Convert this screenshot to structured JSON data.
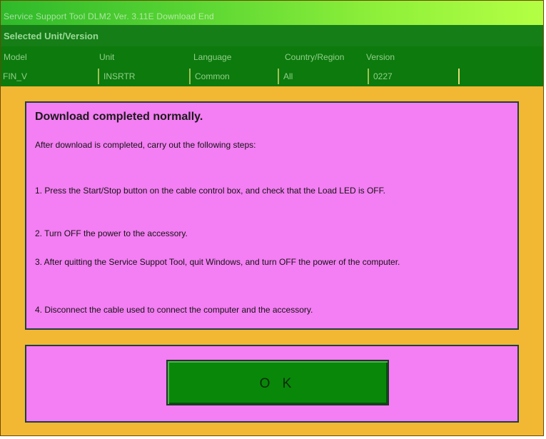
{
  "window": {
    "title": "Service Support Tool DLM2 Ver. 3.11E  Download End"
  },
  "section": {
    "title": "Selected Unit/Version"
  },
  "unit_info": {
    "headers": [
      "Model",
      "Unit",
      "Language",
      "Country/Region",
      "Version"
    ],
    "values": [
      "FIN_V",
      "INSRTR",
      "Common",
      "All",
      "0227"
    ]
  },
  "message": {
    "title": "Download completed normally.",
    "intro": "After download is completed, carry out the following steps:",
    "steps": [
      "1. Press the Start/Stop button on the cable control box, and check that the Load LED is OFF.",
      "2. Turn OFF the power to the accessory.",
      "3. After quitting the Service Suppot Tool, quit Windows, and turn OFF the power of the computer.",
      "4. Disconnect the cable used to connect the computer and the accessory."
    ]
  },
  "buttons": {
    "ok_label": "O K"
  },
  "colors": {
    "window_background": "#f2b733",
    "panel_background": "#f47ef3",
    "header_green": "#0c7a0c",
    "button_green": "#098709"
  }
}
